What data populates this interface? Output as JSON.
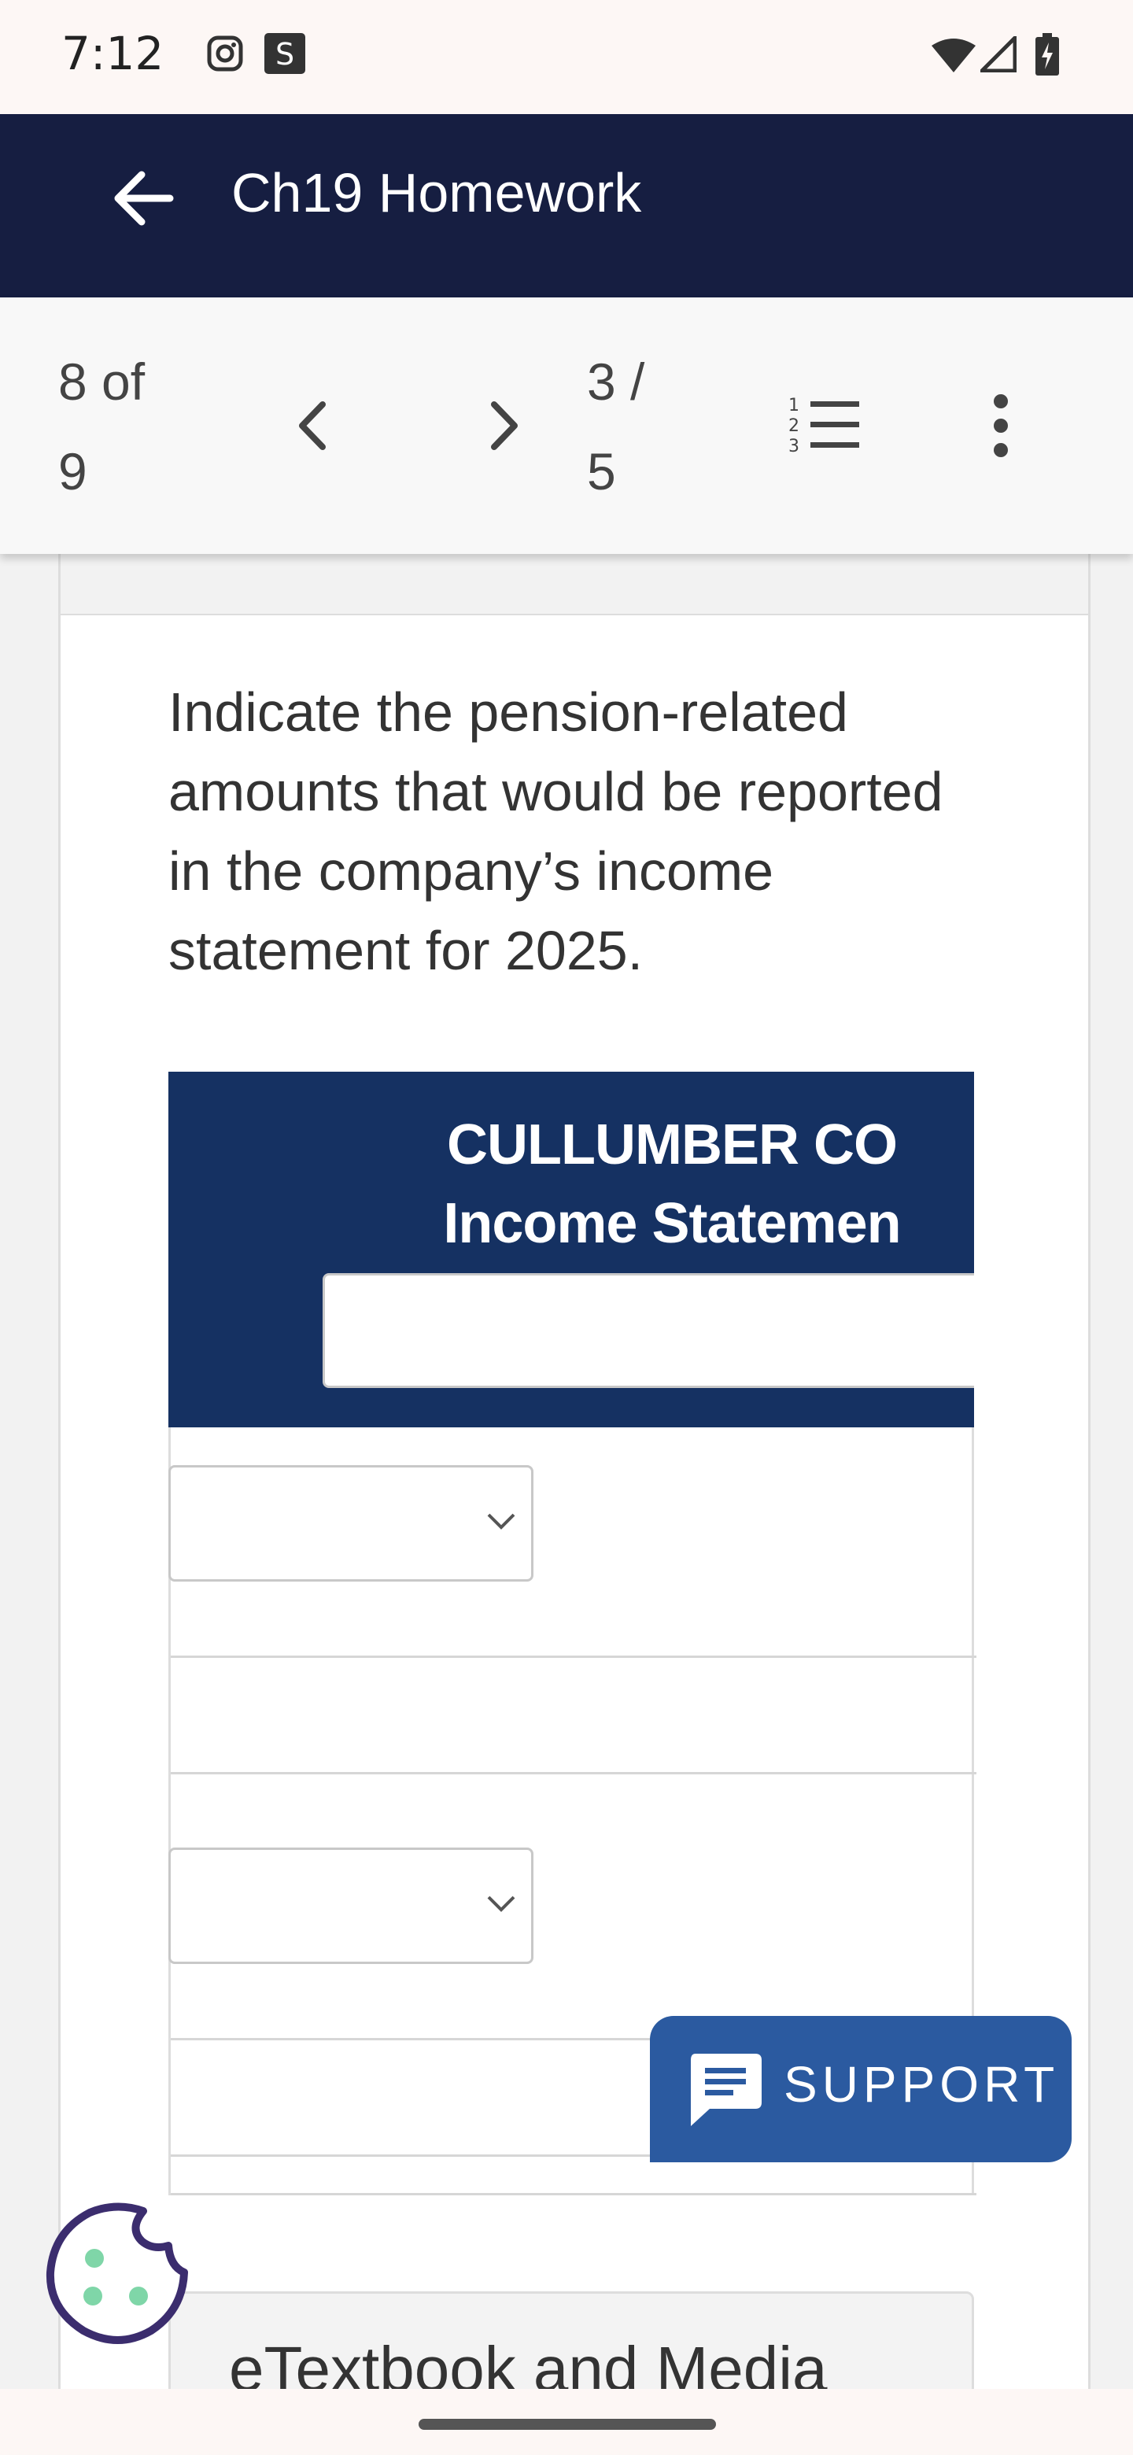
{
  "status_bar": {
    "time": "7:12",
    "icons": [
      "instagram-icon",
      "s-app-icon",
      "wifi-icon",
      "signal-icon",
      "battery-charging-icon"
    ],
    "s_icon_letter": "S"
  },
  "app_bar": {
    "title": "Ch19 Homework",
    "back_icon": "arrow-left-icon"
  },
  "toolbar": {
    "question_position_line1": "8 of",
    "question_position_line2": "9",
    "part_position_line1": "3 /",
    "part_position_line2": "5",
    "icons": [
      "chevron-left-icon",
      "chevron-right-icon",
      "numbered-list-icon",
      "more-vert-icon"
    ]
  },
  "question": {
    "text": "Indicate the pension-related amounts that would be reported in the company’s income statement for 2025."
  },
  "statement": {
    "company": "CULLUMBER CO",
    "title": "Income Statemen",
    "date_value": "",
    "rows": [
      {
        "select_value": "",
        "amount": ""
      },
      {
        "select_value": "",
        "amount": ""
      }
    ]
  },
  "support": {
    "label": "SUPPORT",
    "icon": "chat-bubble-icon"
  },
  "cookie": {
    "icon": "cookie-icon"
  },
  "etextbook": {
    "label": "eTextbook and Media"
  },
  "colors": {
    "app_bar": "#161e41",
    "statement_header": "#153162",
    "support": "#2b5aa0",
    "cookie_outline": "#3b2d6e",
    "cookie_dots": "#7fd6a8"
  }
}
